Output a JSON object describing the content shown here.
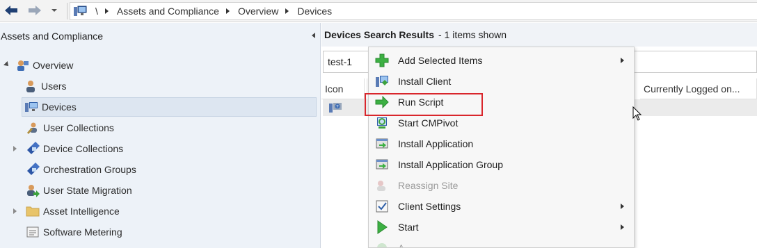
{
  "breadcrumb": {
    "root": "\\",
    "items": [
      "Assets and Compliance",
      "Overview",
      "Devices"
    ]
  },
  "left_pane": {
    "title": "Assets and Compliance",
    "tree": [
      {
        "label": "Overview",
        "icon": "overview-icon"
      },
      {
        "label": "Users",
        "icon": "users-icon"
      },
      {
        "label": "Devices",
        "icon": "devices-icon",
        "selected": true
      },
      {
        "label": "User Collections",
        "icon": "user-collections-icon"
      },
      {
        "label": "Device Collections",
        "icon": "device-collections-icon"
      },
      {
        "label": "Orchestration Groups",
        "icon": "orchestration-groups-icon"
      },
      {
        "label": "User State Migration",
        "icon": "user-state-migration-icon"
      },
      {
        "label": "Asset Intelligence",
        "icon": "folder-icon"
      },
      {
        "label": "Software Metering",
        "icon": "software-metering-icon"
      }
    ]
  },
  "results": {
    "title": "Devices Search Results",
    "count_text": "-  1 items shown",
    "search_value": "test-1",
    "columns": [
      "Icon",
      "Currently Logged on..."
    ]
  },
  "context_menu": {
    "items": [
      {
        "label": "Add Selected Items",
        "icon": "green-plus-icon",
        "submenu": true
      },
      {
        "label": "Install Client",
        "icon": "install-client-icon"
      },
      {
        "label": "Run Script",
        "icon": "green-arrow-icon",
        "highlighted": true
      },
      {
        "label": "Start CMPivot",
        "icon": "cmpivot-icon"
      },
      {
        "label": "Install Application",
        "icon": "install-application-icon"
      },
      {
        "label": "Install Application Group",
        "icon": "install-application-group-icon"
      },
      {
        "label": "Reassign Site",
        "icon": "reassign-site-icon",
        "disabled": true
      },
      {
        "label": "Client Settings",
        "icon": "client-settings-icon",
        "submenu": true
      },
      {
        "label": "Start",
        "icon": "play-icon",
        "submenu": true
      },
      {
        "label": "A...",
        "icon": "partial-icon"
      }
    ]
  },
  "colors": {
    "highlight_border": "#d9262c",
    "left_pane_bg": "#edf2f8",
    "menu_bg": "#f7f7f7"
  }
}
